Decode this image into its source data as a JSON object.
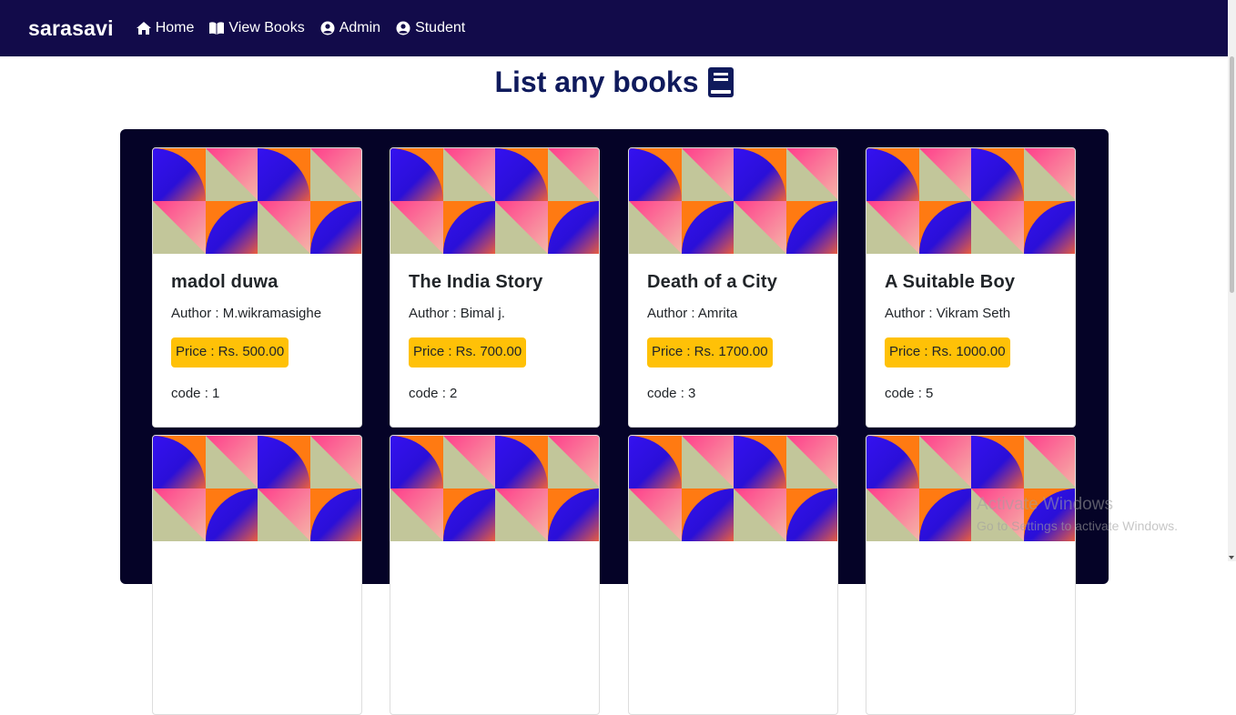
{
  "nav": {
    "brand": "sarasavi",
    "items": [
      {
        "label": "Home",
        "icon": "home-icon"
      },
      {
        "label": "View Books",
        "icon": "book-open-icon"
      },
      {
        "label": "Admin",
        "icon": "user-circle-icon"
      },
      {
        "label": "Student",
        "icon": "user-circle-icon"
      }
    ]
  },
  "page": {
    "title": "List any books"
  },
  "books": [
    {
      "title": "madol duwa",
      "author": "Author : M.wikramasighe",
      "price": "Price : Rs. 500.00",
      "code": "code : 1"
    },
    {
      "title": "The India Story",
      "author": "Author : Bimal j.",
      "price": "Price : Rs. 700.00",
      "code": "code : 2"
    },
    {
      "title": "Death of a City",
      "author": "Author : Amrita",
      "price": "Price : Rs. 1700.00",
      "code": "code : 3"
    },
    {
      "title": "A Suitable Boy",
      "author": "Author : Vikram Seth",
      "price": "Price : Rs. 1000.00",
      "code": "code : 5"
    }
  ],
  "watermark": {
    "title": "Activate Windows",
    "subtitle": "Go to Settings to activate Windows."
  },
  "colors": {
    "navbar": "#120b4a",
    "panel": "#050327",
    "title": "#0f1a5c",
    "badge": "#ffc107"
  }
}
